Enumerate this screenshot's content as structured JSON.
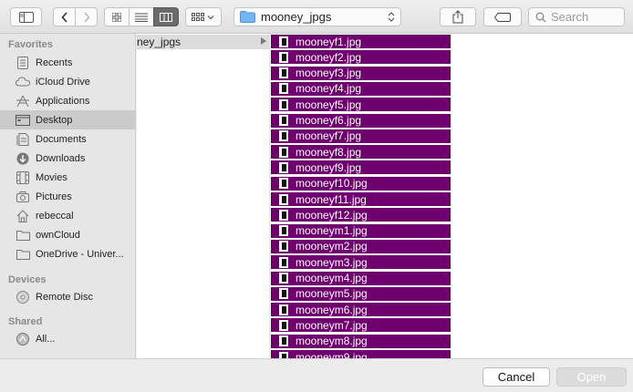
{
  "toolbar": {
    "path_folder": "mooney_jpgs",
    "search_placeholder": "Search"
  },
  "sidebar": {
    "favorites_heading": "Favorites",
    "favorites": [
      {
        "label": "Recents",
        "icon": "recents-icon"
      },
      {
        "label": "iCloud Drive",
        "icon": "cloud-icon"
      },
      {
        "label": "Applications",
        "icon": "applications-icon"
      },
      {
        "label": "Desktop",
        "icon": "desktop-icon",
        "selected": true
      },
      {
        "label": "Documents",
        "icon": "documents-icon"
      },
      {
        "label": "Downloads",
        "icon": "downloads-icon"
      },
      {
        "label": "Movies",
        "icon": "movies-icon"
      },
      {
        "label": "Pictures",
        "icon": "pictures-icon"
      },
      {
        "label": "rebeccal",
        "icon": "home-icon"
      },
      {
        "label": "ownCloud",
        "icon": "folder-icon"
      },
      {
        "label": "OneDrive - Univer...",
        "icon": "folder-icon"
      }
    ],
    "devices_heading": "Devices",
    "devices": [
      {
        "label": "Remote Disc",
        "icon": "disc-icon"
      }
    ],
    "shared_heading": "Shared",
    "shared": [
      {
        "label": "All...",
        "icon": "network-icon"
      }
    ]
  },
  "browser": {
    "parent_column_item": "ney_jpgs",
    "selection_color": "#6e006e",
    "files": [
      "mooneyf1.jpg",
      "mooneyf2.jpg",
      "mooneyf3.jpg",
      "mooneyf4.jpg",
      "mooneyf5.jpg",
      "mooneyf6.jpg",
      "mooneyf7.jpg",
      "mooneyf8.jpg",
      "mooneyf9.jpg",
      "mooneyf10.jpg",
      "mooneyf11.jpg",
      "mooneyf12.jpg",
      "mooneym1.jpg",
      "mooneym2.jpg",
      "mooneym3.jpg",
      "mooneym4.jpg",
      "mooneym5.jpg",
      "mooneym6.jpg",
      "mooneym7.jpg",
      "mooneym8.jpg",
      "mooneym9.jpg"
    ]
  },
  "footer": {
    "cancel_label": "Cancel",
    "open_label": "Open"
  }
}
